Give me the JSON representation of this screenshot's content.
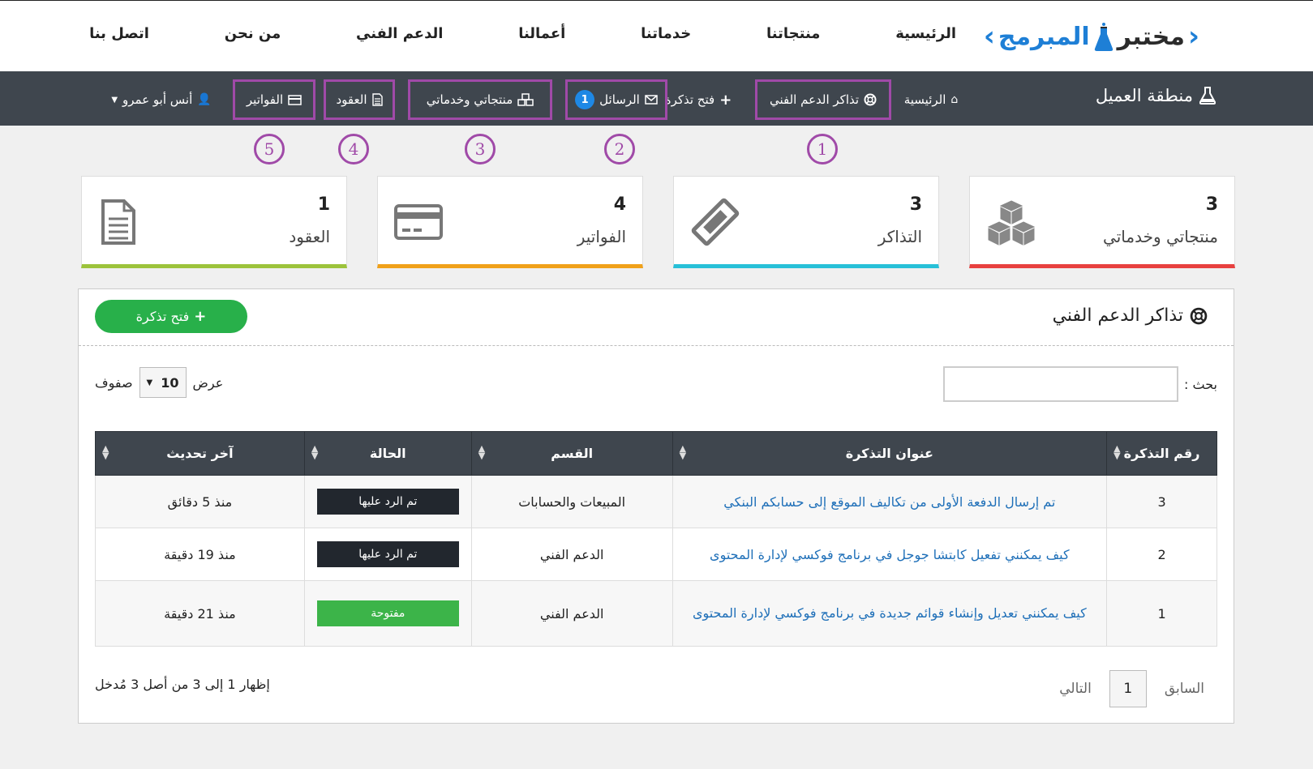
{
  "site": {
    "logo_prefix": "مختبر",
    "logo_suffix": "المبرمج",
    "nav": [
      "الرئيسية",
      "منتجاتنا",
      "خدماتنا",
      "أعمالنا",
      "الدعم الفني",
      "من نحن",
      "اتصل بنا"
    ]
  },
  "client_bar": {
    "title": "منطقة العميل",
    "home": "الرئيسية",
    "tickets": "تذاكر الدعم الفني",
    "open_ticket": "فتح تذكرة",
    "messages": "الرسائل",
    "messages_badge": "1",
    "products": "منتجاتي وخدماتي",
    "contracts": "العقود",
    "invoices": "الفواتير",
    "user": "أنس أبو عمرو"
  },
  "steps": [
    "1",
    "2",
    "3",
    "4",
    "5"
  ],
  "cards": [
    {
      "value": "3",
      "label": "منتجاتي وخدماتي",
      "color": "#e8413f",
      "icon": "cubes-icon"
    },
    {
      "value": "3",
      "label": "التذاكر",
      "color": "#27c0d8",
      "icon": "ticket-icon"
    },
    {
      "value": "4",
      "label": "الفواتير",
      "color": "#f0a11a",
      "icon": "credit-card-icon"
    },
    {
      "value": "1",
      "label": "العقود",
      "color": "#9cc33b",
      "icon": "document-icon"
    }
  ],
  "panel": {
    "title": "تذاكر الدعم الفني",
    "open_button": "فتح تذكرة",
    "search_label": "بحث :",
    "search_value": "",
    "length_prefix": "عرض",
    "length_value": "10",
    "length_suffix": "صفوف"
  },
  "table": {
    "headers": [
      "رقم التذكرة",
      "عنوان التذكرة",
      "القسم",
      "الحالة",
      "آخر تحديث"
    ],
    "rows": [
      {
        "id": "3",
        "subject": "تم إرسال الدفعة الأولى من تكاليف الموقع إلى حسابكم البنكي",
        "dept": "المبيعات والحسابات",
        "status": "تم الرد عليها",
        "status_color": "#22272e",
        "updated": "منذ 5 دقائق"
      },
      {
        "id": "2",
        "subject": "كيف يمكنني تفعيل كابتشا جوجل في برنامج فوكسي لإدارة المحتوى",
        "dept": "الدعم الفني",
        "status": "تم الرد عليها",
        "status_color": "#22272e",
        "updated": "منذ 19 دقيقة"
      },
      {
        "id": "1",
        "subject": "كيف يمكنني تعديل وإنشاء قوائم جديدة في برنامج فوكسي لإدارة المحتوى",
        "dept": "الدعم الفني",
        "status": "مفتوحة",
        "status_color": "#3cb449",
        "updated": "منذ 21 دقيقة"
      }
    ]
  },
  "footer": {
    "info": "إظهار 1 إلى 3 من أصل 3 مُدخل",
    "prev": "السابق",
    "page": "1",
    "next": "التالي"
  },
  "colors": {
    "accent": "#a04aa8",
    "brand": "#1e7fd6",
    "bar": "#3f464e",
    "green": "#28b04a"
  }
}
